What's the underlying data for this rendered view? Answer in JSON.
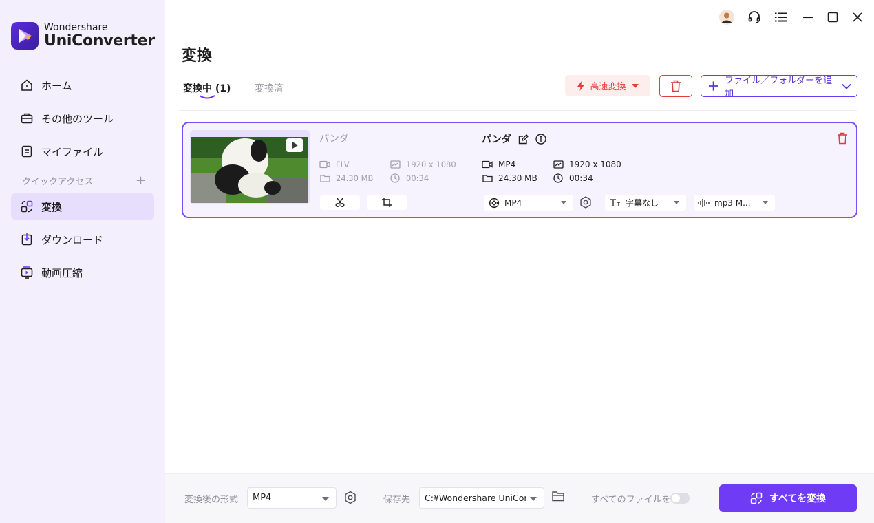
{
  "app": {
    "brand_line1": "Wondershare",
    "brand_line2": "UniConverter",
    "accent": "#6f3bf5"
  },
  "sidebar": {
    "items": [
      {
        "label": "ホーム",
        "icon": "home-icon"
      },
      {
        "label": "その他のツール",
        "icon": "toolbox-icon"
      },
      {
        "label": "マイファイル",
        "icon": "file-icon"
      },
      {
        "label": "変換",
        "icon": "convert-icon",
        "active": true
      },
      {
        "label": "ダウンロード",
        "icon": "download-icon"
      },
      {
        "label": "動画圧縮",
        "icon": "compress-icon"
      }
    ],
    "quick_access_label": "クイックアクセス"
  },
  "window_controls": [
    "user-avatar-icon",
    "headset-icon",
    "menu-icon",
    "minimize-icon",
    "maximize-icon",
    "close-icon"
  ],
  "main": {
    "title": "変換",
    "tabs": [
      {
        "label": "変換中 (1)",
        "active": true
      },
      {
        "label": "変換済",
        "active": false
      }
    ],
    "toolbar": {
      "speed_label": "高速変換",
      "add_label": "ファイル／フォルダーを追加"
    }
  },
  "file": {
    "source": {
      "name": "パンダ",
      "format": "FLV",
      "resolution": "1920 x 1080",
      "size": "24.30 MB",
      "duration": "00:34"
    },
    "target": {
      "name": "パンダ",
      "format": "MP4",
      "resolution": "1920 x 1080",
      "size": "24.30 MB",
      "duration": "00:34",
      "format_select": "MP4",
      "subtitle_select": "字幕なし",
      "audio_select": "mp3 M..."
    }
  },
  "bottom": {
    "format_label": "変換後の形式",
    "format_value": "MP4",
    "save_label": "保存先",
    "save_path": "C:¥Wondershare UniConverter",
    "merge_label": "すべてのファイルを...",
    "convert_all_label": "すべてを変換"
  }
}
